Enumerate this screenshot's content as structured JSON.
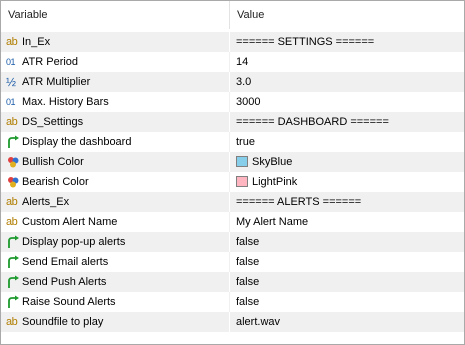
{
  "header": {
    "variable": "Variable",
    "value": "Value"
  },
  "rows": [
    {
      "type": "string",
      "icon": "string-icon",
      "variable": "In_Ex",
      "value": "====== SETTINGS ======"
    },
    {
      "type": "int",
      "icon": "integer-icon",
      "variable": "ATR Period",
      "value": "14"
    },
    {
      "type": "double",
      "icon": "fraction-icon",
      "variable": "ATR Multiplier",
      "value": "3.0"
    },
    {
      "type": "int",
      "icon": "integer-icon",
      "variable": "Max. History Bars",
      "value": "3000"
    },
    {
      "type": "string",
      "icon": "string-icon",
      "variable": "DS_Settings",
      "value": "====== DASHBOARD ======"
    },
    {
      "type": "bool",
      "icon": "boolean-arrow-icon",
      "variable": "Display the dashboard",
      "value": "true"
    },
    {
      "type": "color",
      "icon": "palette-icon",
      "variable": "Bullish Color",
      "value": "SkyBlue",
      "swatch": "#87ceeb"
    },
    {
      "type": "color",
      "icon": "palette-icon",
      "variable": "Bearish Color",
      "value": "LightPink",
      "swatch": "#ffb6c1"
    },
    {
      "type": "string",
      "icon": "string-icon",
      "variable": "Alerts_Ex",
      "value": "====== ALERTS ======"
    },
    {
      "type": "string",
      "icon": "string-icon",
      "variable": "Custom Alert Name",
      "value": "My Alert Name"
    },
    {
      "type": "bool",
      "icon": "boolean-arrow-icon",
      "variable": "Display pop-up alerts",
      "value": "false"
    },
    {
      "type": "bool",
      "icon": "boolean-arrow-icon",
      "variable": "Send Email alerts",
      "value": "false"
    },
    {
      "type": "bool",
      "icon": "boolean-arrow-icon",
      "variable": "Send Push Alerts",
      "value": "false"
    },
    {
      "type": "bool",
      "icon": "boolean-arrow-icon",
      "variable": "Raise Sound Alerts",
      "value": "false"
    },
    {
      "type": "string",
      "icon": "string-icon",
      "variable": "Soundfile to play",
      "value": "alert.wav"
    }
  ]
}
